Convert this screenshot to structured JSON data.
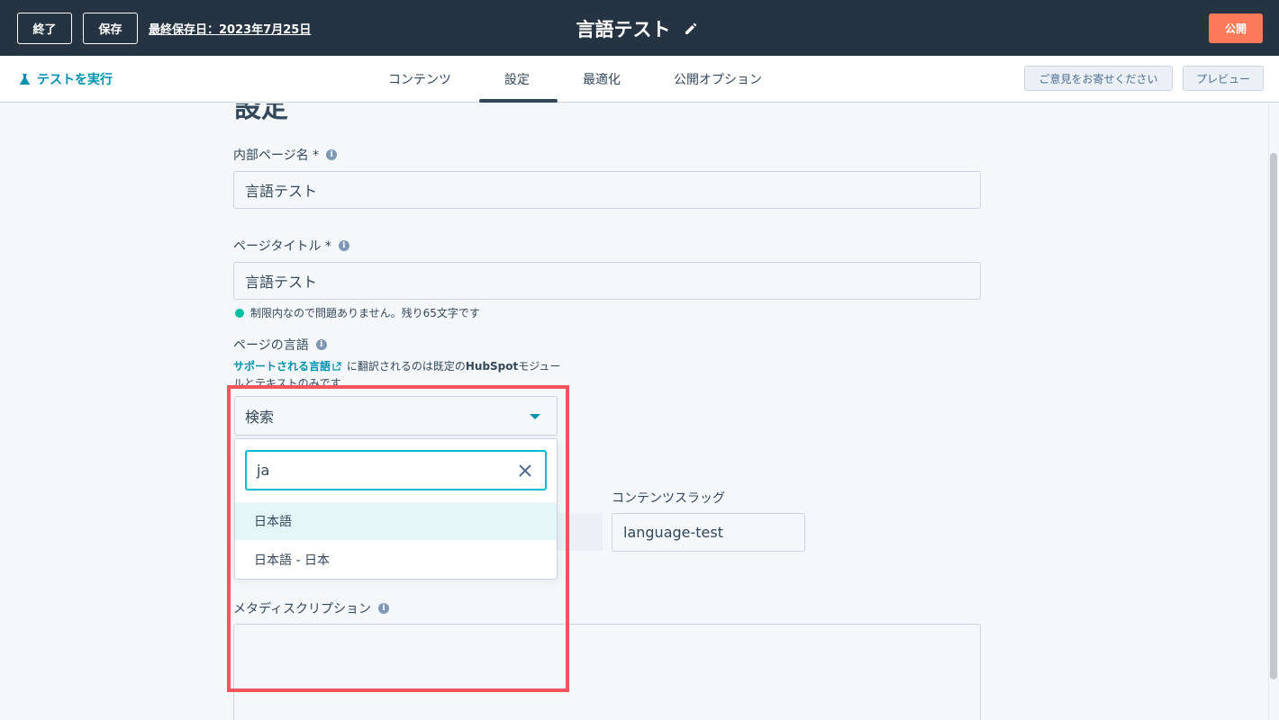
{
  "topbar": {
    "exit_label": "終了",
    "save_label": "保存",
    "last_saved": "最終保存日：2023年7月25日",
    "doc_title": "言語テスト",
    "publish_label": "公開"
  },
  "subbar": {
    "run_test_label": "テストを実行",
    "tabs": [
      {
        "label": "コンテンツ",
        "active": false
      },
      {
        "label": "設定",
        "active": true
      },
      {
        "label": "最適化",
        "active": false
      },
      {
        "label": "公開オプション",
        "active": false
      }
    ],
    "feedback_label": "ご意見をお寄せください",
    "preview_label": "プレビュー"
  },
  "settings": {
    "section_title": "設定",
    "internal_name": {
      "label": "内部ページ名 *",
      "value": "言語テスト"
    },
    "page_title": {
      "label": "ページタイトル *",
      "value": "言語テスト",
      "hint": "制限内なので問題ありません。残り65文字です"
    },
    "language": {
      "label": "ページの言語",
      "help_link": "サポートされる言語",
      "help_text_1": "に翻訳されるのは既定の",
      "help_brand": "HubSpot",
      "help_text_2": "モジュールとテキストのみです",
      "select_placeholder": "検索",
      "search_value": "ja",
      "options": [
        "日本語",
        "日本語 - 日本"
      ]
    },
    "content_slug": {
      "label": "コンテンツスラッグ",
      "value": "language-test"
    },
    "meta_description": {
      "label": "メタディスクリプション",
      "value": ""
    }
  },
  "colors": {
    "topbar_bg": "#253342",
    "publish": "#ff7a59",
    "link": "#0091ae",
    "highlight": "#f2545b",
    "success": "#00bda5"
  }
}
